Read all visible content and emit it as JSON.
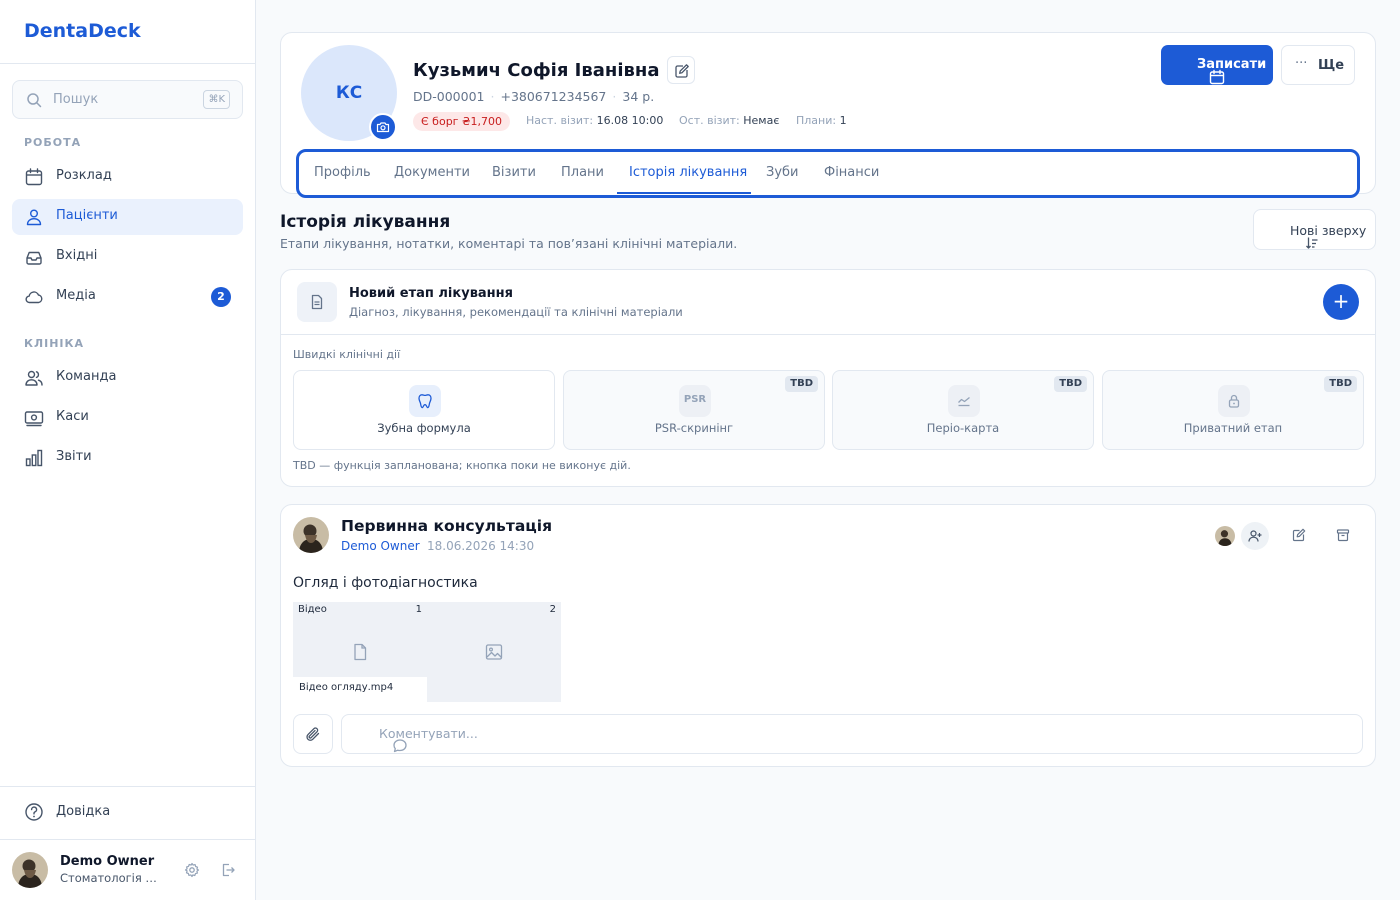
{
  "app": {
    "name": "DentaDeck"
  },
  "search": {
    "placeholder": "Пошук",
    "shortcut": "⌘K"
  },
  "nav": {
    "work_title": "РОБОТА",
    "work_items": [
      {
        "label": "Розклад",
        "icon": "calendar-icon"
      },
      {
        "label": "Пацієнти",
        "icon": "users-icon",
        "active": true
      },
      {
        "label": "Вхідні",
        "icon": "inbox-icon"
      },
      {
        "label": "Медіа",
        "icon": "cloud-icon",
        "badge": "2"
      }
    ],
    "clinic_title": "КЛІНІКА",
    "clinic_items": [
      {
        "label": "Команда",
        "icon": "team-icon"
      },
      {
        "label": "Каси",
        "icon": "cash-register-icon"
      },
      {
        "label": "Звіти",
        "icon": "bar-chart-icon"
      }
    ],
    "help": "Довідка"
  },
  "user": {
    "name": "Demo Owner",
    "clinic": "Стоматологія П..."
  },
  "patient": {
    "initials": "КС",
    "name": "Кузьмич Софія Іванівна",
    "id": "DD-000001",
    "phone": "+380671234567",
    "age": "34 р.",
    "debt": "Є борг ₴1,700",
    "next_visit_label": "Наст. візит:",
    "next_visit": "16.08 10:00",
    "last_visit_label": "Ост. візит:",
    "last_visit": "Немає",
    "plans_label": "Плани:",
    "plans": "1"
  },
  "actions": {
    "book": "Записати",
    "more": "Ще"
  },
  "tabs": [
    {
      "label": "Профіль"
    },
    {
      "label": "Документи"
    },
    {
      "label": "Візити"
    },
    {
      "label": "Плани"
    },
    {
      "label": "Історія лікування",
      "active": true
    },
    {
      "label": "Зуби"
    },
    {
      "label": "Фінанси"
    }
  ],
  "history": {
    "title": "Історія лікування",
    "subtitle": "Етапи лікування, нотатки, коментарі та пов’язані клінічні матеріали.",
    "sort": "Нові зверху"
  },
  "new_stage": {
    "title": "Новий етап лікування",
    "subtitle": "Діагноз, лікування, рекомендації та клінічні матеріали",
    "add": "+",
    "quick_label": "Швидкі клінічні дії",
    "quick_actions": [
      {
        "label": "Зубна формула",
        "icon": "tooth-icon",
        "tbd": ""
      },
      {
        "label": "PSR-скринінг",
        "icon_text": "PSR",
        "tbd": "TBD"
      },
      {
        "label": "Періо-карта",
        "icon": "perio-chart-icon",
        "tbd": "TBD"
      },
      {
        "label": "Приватний етап",
        "icon": "lock-icon",
        "tbd": "TBD"
      }
    ],
    "note": "TBD — функція запланована; кнопка поки не виконує дій."
  },
  "entry": {
    "title": "Первинна консультація",
    "author": "Demo Owner",
    "date": "18.06.2026 14:30",
    "text": "Огляд і фотодіагностика",
    "media": [
      {
        "label": "Відео",
        "num": "1",
        "name": "Відео огляду.mp4",
        "icon": "file-icon"
      },
      {
        "label": "",
        "num": "2",
        "name": "",
        "icon": "image-icon"
      }
    ],
    "comment_placeholder": "Коментувати..."
  },
  "colors": {
    "accent": "#1d5bd6",
    "debt_bg": "#fde8e8",
    "debt_text": "#c81e1e"
  }
}
